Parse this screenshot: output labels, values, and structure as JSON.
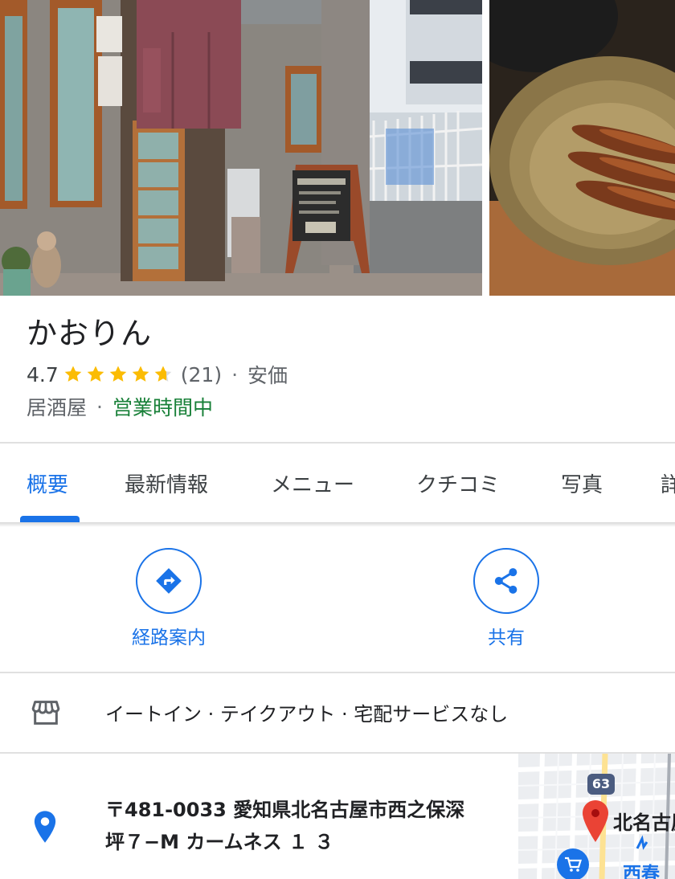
{
  "place": {
    "name": "かおりん",
    "rating": "4.7",
    "review_count": "(21)",
    "price_level": "安価",
    "category": "居酒屋",
    "open_status": "営業時間中",
    "star_rating_value": 4.7
  },
  "separator": "·",
  "tabs": [
    {
      "label": "概要",
      "active": true
    },
    {
      "label": "最新情報",
      "active": false
    },
    {
      "label": "メニュー",
      "active": false
    },
    {
      "label": "クチコミ",
      "active": false
    },
    {
      "label": "写真",
      "active": false
    },
    {
      "label": "詳",
      "active": false
    }
  ],
  "actions": {
    "directions": {
      "label": "経路案内",
      "icon": "directions-icon"
    },
    "share": {
      "label": "共有",
      "icon": "share-icon"
    }
  },
  "service_options": {
    "icon": "storefront-icon",
    "text": "イートイン · テイクアウト · 宅配サービスなし"
  },
  "address": {
    "icon": "location-pin-icon",
    "line1": "〒481-0033 愛知県北名古屋市西之保深",
    "line2": "坪７−M カームネス １ ３"
  },
  "map_preview": {
    "route_number": "63",
    "city_label": "北名古屋",
    "station_label": "西春"
  },
  "colors": {
    "accent": "#1a73e8",
    "open": "#188038",
    "star": "#fbbc04",
    "text_secondary": "#5f6368",
    "map_pin": "#ea4335"
  }
}
